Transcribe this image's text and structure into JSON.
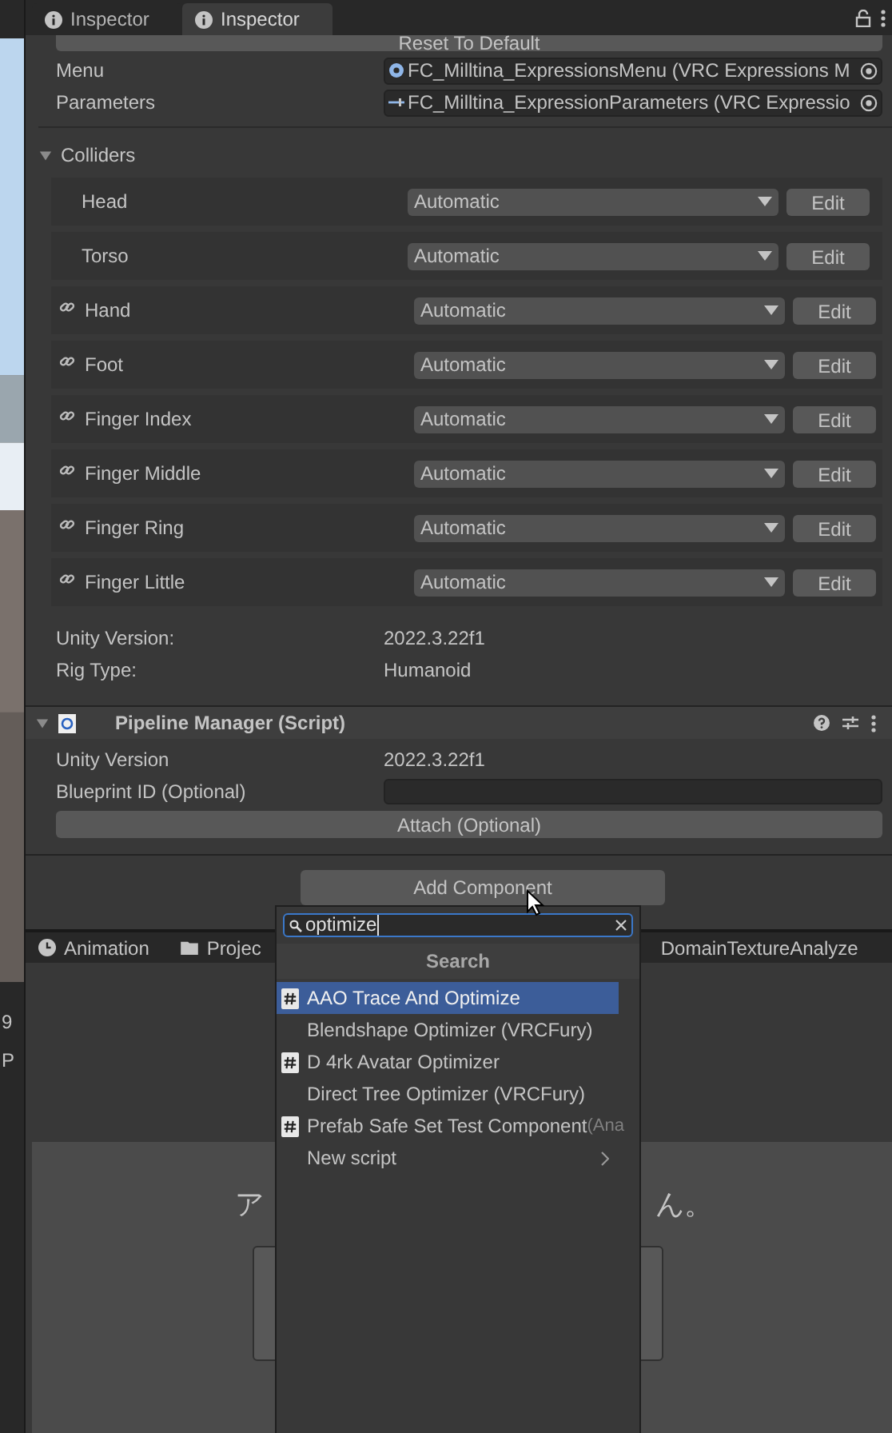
{
  "tabs": [
    {
      "label": "Inspector",
      "selected": false
    },
    {
      "label": "Inspector",
      "selected": true
    }
  ],
  "reset_button": "Reset To Default",
  "object_fields": [
    {
      "label": "Menu",
      "value": "FC_Milltina_ExpressionsMenu (VRC Expressions M",
      "kind": "menu"
    },
    {
      "label": "Parameters",
      "value": "FC_Milltina_ExpressionParameters (VRC Expressio",
      "kind": "parameters"
    }
  ],
  "colliders": {
    "title": "Colliders",
    "expanded": true,
    "rows": [
      {
        "name": "Head",
        "linked": false,
        "value": "Automatic",
        "button": "Edit"
      },
      {
        "name": "Torso",
        "linked": false,
        "value": "Automatic",
        "button": "Edit"
      },
      {
        "name": "Hand",
        "linked": true,
        "value": "Automatic",
        "button": "Edit"
      },
      {
        "name": "Foot",
        "linked": true,
        "value": "Automatic",
        "button": "Edit"
      },
      {
        "name": "Finger Index",
        "linked": true,
        "value": "Automatic",
        "button": "Edit"
      },
      {
        "name": "Finger Middle",
        "linked": true,
        "value": "Automatic",
        "button": "Edit"
      },
      {
        "name": "Finger Ring",
        "linked": true,
        "value": "Automatic",
        "button": "Edit"
      },
      {
        "name": "Finger Little",
        "linked": true,
        "value": "Automatic",
        "button": "Edit"
      }
    ]
  },
  "avatar_info": [
    {
      "label": "Unity Version:",
      "value": "2022.3.22f1"
    },
    {
      "label": "Rig Type:",
      "value": "Humanoid"
    }
  ],
  "pipeline_manager": {
    "title": "Pipeline Manager (Script)",
    "expanded": true,
    "unity_version_label": "Unity Version",
    "unity_version": "2022.3.22f1",
    "blueprint_label": "Blueprint ID (Optional)",
    "attach_button": "Attach (Optional)"
  },
  "add_component_button": "Add Component",
  "bottom_tabs": [
    {
      "label": "Animation",
      "kind": "clock"
    },
    {
      "label": "Projec",
      "kind": "folder"
    },
    {
      "label": "DomainTextureAnalyze",
      "kind": "plain"
    }
  ],
  "bottom_panel_texts": [
    "ア",
    "ん。"
  ],
  "left_strip_texts": [
    "9",
    "P"
  ],
  "popup": {
    "search_value": "optimize",
    "header": "Search",
    "items": [
      {
        "label": "AAO Trace And Optimize",
        "script_icon": true,
        "selected": true,
        "kind": "item"
      },
      {
        "label": "Blendshape Optimizer (VRCFury)",
        "script_icon": false,
        "selected": false,
        "kind": "item"
      },
      {
        "label": "D 4rk Avatar Optimizer",
        "script_icon": true,
        "selected": false,
        "kind": "item"
      },
      {
        "label": "Direct Tree Optimizer (VRCFury)",
        "script_icon": false,
        "selected": false,
        "kind": "item"
      },
      {
        "label": "Prefab Safe Set Test Component",
        "suffix": "(Ana",
        "script_icon": true,
        "selected": false,
        "kind": "item"
      },
      {
        "label": "New script",
        "script_icon": false,
        "selected": false,
        "kind": "submenu"
      }
    ]
  }
}
